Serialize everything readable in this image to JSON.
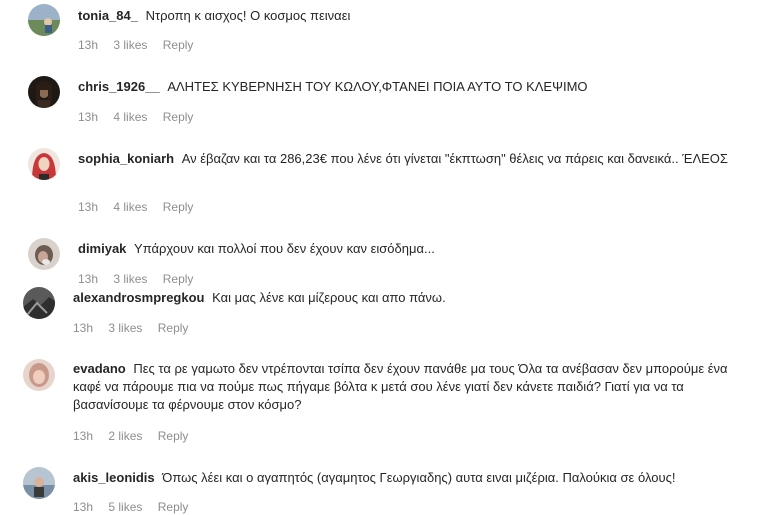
{
  "comments": [
    {
      "username": "tonia_84_",
      "text": "Ντροπη κ αισχος! Ο κοσμος πειναει",
      "time": "13h",
      "likes": "3 likes",
      "reply": "Reply"
    },
    {
      "username": "chris_1926__",
      "text": "ΑΛΗΤΕΣ ΚΥΒΕΡΝΗΣΗ ΤΟΥ ΚΩΛΟΥ,ΦΤΑΝΕΙ ΠΟΙΑ ΑΥΤΟ ΤΟ ΚΛΕΨΙΜΟ",
      "time": "13h",
      "likes": "4 likes",
      "reply": "Reply"
    },
    {
      "username": "sophia_koniarh",
      "text": "Αν έβαζαν και τα 286,23€ που λένε ότι γίνεται \"έκπτωση\" θέλεις να πάρεις και δανεικά.. ΈΛΕΟΣ",
      "time": "13h",
      "likes": "4 likes",
      "reply": "Reply"
    },
    {
      "username": "dimiyak",
      "text": "Υπάρχουν και πολλοί που δεν έχουν καν εισόδημα...",
      "time": "13h",
      "likes": "3 likes",
      "reply": "Reply"
    },
    {
      "username": "alexandrosmpregkou",
      "text": "Και μας λένε και μίζερους και απο πάνω.",
      "time": "13h",
      "likes": "3 likes",
      "reply": "Reply"
    },
    {
      "username": "evadano",
      "text": "Πες τα ρε γαμωτο δεν ντρέπονται τσίπα δεν έχουν πανάθε μα τους Όλα τα ανέβασαν δεν μπορούμε ένα καφέ να πάρουμε πια να πούμε πως πήγαμε βόλτα κ μετά σου λένε γιατί δεν κάνετε παιδιά? Γιατί για να τα βασανίσουμε τα φέρνουμε στον κόσμο?",
      "time": "13h",
      "likes": "2 likes",
      "reply": "Reply"
    },
    {
      "username": "akis_leonidis",
      "text": "Όπως λέει και ο αγαπητός (αγαμητος Γεωργιαδης) αυτα ειναι μιζέρια. Παλούκια σε όλους!",
      "time": "13h",
      "likes": "5 likes",
      "reply": "Reply"
    }
  ],
  "avatar_colors": [
    "#6d8b5a",
    "#3b2a22",
    "#c8383a",
    "#6e5b52",
    "#4a4a4a",
    "#c79a8c",
    "#7a8fa6"
  ]
}
